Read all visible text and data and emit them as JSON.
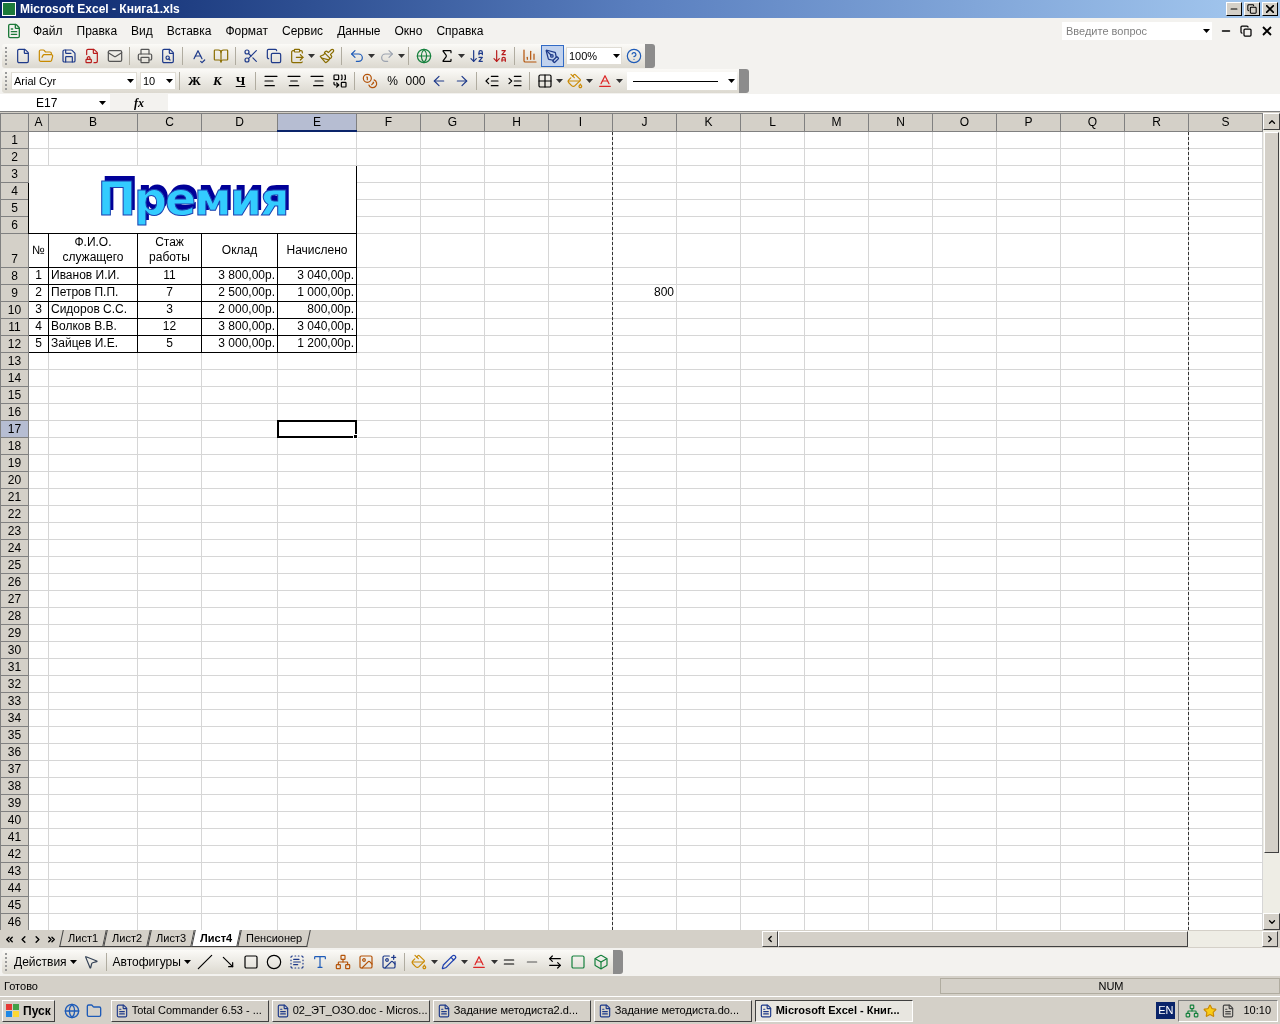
{
  "window": {
    "title": "Microsoft Excel - Книга1.xls"
  },
  "menu": {
    "items": [
      "Файл",
      "Правка",
      "Вид",
      "Вставка",
      "Формат",
      "Сервис",
      "Данные",
      "Окно",
      "Справка"
    ]
  },
  "help_search": {
    "placeholder": "Введите вопрос"
  },
  "standard_toolbar": {
    "zoom": "100%"
  },
  "formatting_toolbar": {
    "font": "Arial Cyr",
    "size": "10",
    "buttons": [
      {
        "label": "Ж",
        "kind": "bold"
      },
      {
        "label": "К",
        "kind": "italic"
      },
      {
        "label": "Ч",
        "kind": "underline"
      }
    ],
    "number_buttons": [
      "%",
      "000"
    ]
  },
  "formula_bar": {
    "name_box": "E17",
    "function_label": "fx"
  },
  "sheet": {
    "columns": [
      {
        "label": "A",
        "selected": false,
        "page_break": false
      },
      {
        "label": "B",
        "selected": false,
        "page_break": false
      },
      {
        "label": "C",
        "selected": false,
        "page_break": false
      },
      {
        "label": "D",
        "selected": false,
        "page_break": false
      },
      {
        "label": "E",
        "selected": true,
        "page_break": false
      },
      {
        "label": "F",
        "selected": false,
        "page_break": false
      },
      {
        "label": "G",
        "selected": false,
        "page_break": false
      },
      {
        "label": "H",
        "selected": false,
        "page_break": false
      },
      {
        "label": "I",
        "selected": false,
        "page_break": true
      },
      {
        "label": "J",
        "selected": false,
        "page_break": false
      },
      {
        "label": "K",
        "selected": false,
        "page_break": false
      },
      {
        "label": "L",
        "selected": false,
        "page_break": false
      },
      {
        "label": "M",
        "selected": false,
        "page_break": false
      },
      {
        "label": "N",
        "selected": false,
        "page_break": false
      },
      {
        "label": "O",
        "selected": false,
        "page_break": false
      },
      {
        "label": "P",
        "selected": false,
        "page_break": false
      },
      {
        "label": "Q",
        "selected": false,
        "page_break": false
      },
      {
        "label": "R",
        "selected": false,
        "page_break": true
      },
      {
        "label": "S",
        "selected": false,
        "page_break": false
      }
    ],
    "rows": [
      {
        "label": "1",
        "selected": false
      },
      {
        "label": "2",
        "selected": false
      },
      {
        "label": "3",
        "selected": false
      },
      {
        "label": "4",
        "selected": false
      },
      {
        "label": "5",
        "selected": false
      },
      {
        "label": "6",
        "selected": false
      },
      {
        "label": "7",
        "selected": false
      },
      {
        "label": "8",
        "selected": false
      },
      {
        "label": "9",
        "selected": false
      },
      {
        "label": "10",
        "selected": false
      },
      {
        "label": "11",
        "selected": false
      },
      {
        "label": "12",
        "selected": false
      },
      {
        "label": "13",
        "selected": false
      },
      {
        "label": "14",
        "selected": false
      },
      {
        "label": "15",
        "selected": false
      },
      {
        "label": "16",
        "selected": false
      },
      {
        "label": "17",
        "selected": true
      },
      {
        "label": "18",
        "selected": false
      },
      {
        "label": "19",
        "selected": false
      },
      {
        "label": "20",
        "selected": false
      },
      {
        "label": "21",
        "selected": false
      },
      {
        "label": "22",
        "selected": false
      },
      {
        "label": "23",
        "selected": false
      },
      {
        "label": "24",
        "selected": false
      },
      {
        "label": "25",
        "selected": false
      },
      {
        "label": "26",
        "selected": false
      },
      {
        "label": "27",
        "selected": false
      },
      {
        "label": "28",
        "selected": false
      },
      {
        "label": "29",
        "selected": false
      },
      {
        "label": "30",
        "selected": false
      },
      {
        "label": "31",
        "selected": false
      },
      {
        "label": "32",
        "selected": false
      },
      {
        "label": "33",
        "selected": false
      },
      {
        "label": "34",
        "selected": false
      },
      {
        "label": "35",
        "selected": false
      },
      {
        "label": "36",
        "selected": false
      },
      {
        "label": "37",
        "selected": false
      },
      {
        "label": "38",
        "selected": false
      },
      {
        "label": "39",
        "selected": false
      },
      {
        "label": "40",
        "selected": false
      },
      {
        "label": "41",
        "selected": false
      },
      {
        "label": "42",
        "selected": false
      },
      {
        "label": "43",
        "selected": false
      },
      {
        "label": "44",
        "selected": false
      },
      {
        "label": "45",
        "selected": false
      },
      {
        "label": "46",
        "selected": false
      }
    ],
    "wordart": "Премия",
    "table": {
      "header": [
        "№",
        "Ф.И.О. служащего",
        "Стаж работы",
        "Оклад",
        "Начислено"
      ],
      "rows": [
        [
          "1",
          "Иванов И.И.",
          "11",
          "3 800,00р.",
          "3 040,00р."
        ],
        [
          "2",
          "Петров П.П.",
          "7",
          "2 500,00р.",
          "1 000,00р."
        ],
        [
          "3",
          "Сидоров С.С.",
          "3",
          "2 000,00р.",
          "800,00р."
        ],
        [
          "4",
          "Волков В.В.",
          "12",
          "3 800,00р.",
          "3 040,00р."
        ],
        [
          "5",
          "Зайцев И.Е.",
          "5",
          "3 000,00р.",
          "1 200,00р."
        ]
      ]
    },
    "cell_j9": "800"
  },
  "sheet_tabs": [
    {
      "label": "Лист1",
      "selected": false
    },
    {
      "label": "Лист2",
      "selected": false
    },
    {
      "label": "Лист3",
      "selected": false
    },
    {
      "label": "Лист4",
      "selected": true
    },
    {
      "label": "Пенсионер",
      "selected": false
    }
  ],
  "drawing_toolbar": {
    "actions": "Действия",
    "autoshapes": "Автофигуры"
  },
  "status_bar": {
    "status": "Готово",
    "num": "NUM"
  },
  "taskbar": {
    "start": "Пуск",
    "tasks": [
      {
        "label": "Total Commander 6.53 - ...",
        "selected": false
      },
      {
        "label": "02_ЭТ_ОЗО.doc - Micros...",
        "selected": false
      },
      {
        "label": "Задание методиста2.d...",
        "selected": false
      },
      {
        "label": "Задание методиста.do...",
        "selected": false
      },
      {
        "label": "Microsoft Excel - Книг...",
        "selected": true
      }
    ],
    "language": "EN",
    "clock": "10:10"
  }
}
